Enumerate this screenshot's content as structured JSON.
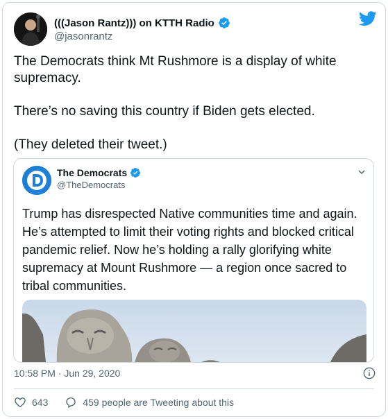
{
  "tweet": {
    "display_name": "(((Jason Rantz))) on KTTH Radio",
    "handle": "@jasonrantz",
    "paragraphs": [
      "The Democrats think Mt Rushmore is a display of white supremacy.",
      "There’s no saving this country if Biden gets elected.",
      "(They deleted their tweet.)"
    ],
    "timestamp": "10:58 PM · Jun 29, 2020",
    "likes": "643",
    "conversation": "459 people are Tweeting about this"
  },
  "quoted": {
    "display_name": "The Democrats",
    "handle": "@TheDemocrats",
    "avatar_letter": "D",
    "text": "Trump has disrespected Native communities time and again. He’s attempted to limit their voting rights and blocked critical pandemic relief. Now he’s holding a rally glorifying white supremacy at Mount Rushmore — a region once sacred to tribal communities."
  },
  "colors": {
    "brand_blue": "#1d9bf0",
    "dem_blue": "#1d7fd6",
    "text": "#0f1419",
    "muted": "#536471"
  },
  "icons": {
    "verified": "verified-badge-icon",
    "logo": "twitter-bird-icon",
    "chevron": "chevron-down-icon",
    "info": "info-icon",
    "like": "heart-icon",
    "reply": "speech-bubble-icon"
  }
}
